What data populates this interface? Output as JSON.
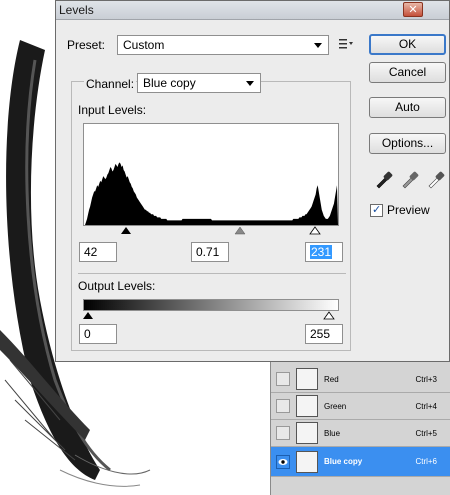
{
  "dialog": {
    "title": "Levels",
    "close_glyph": "✕",
    "preset_label": "Preset:",
    "preset_value": "Custom",
    "channel_label": "Channel:",
    "channel_value": "Blue copy",
    "input_levels_label": "Input Levels:",
    "input_black": "42",
    "input_gamma": "0.71",
    "input_white": "231",
    "output_levels_label": "Output Levels:",
    "output_black": "0",
    "output_white": "255"
  },
  "buttons": {
    "ok": "OK",
    "cancel": "Cancel",
    "auto": "Auto",
    "options": "Options..."
  },
  "preview": {
    "label": "Preview",
    "checked": true
  },
  "channels": [
    {
      "name": "Red",
      "shortcut": "Ctrl+3",
      "selected": false
    },
    {
      "name": "Green",
      "shortcut": "Ctrl+4",
      "selected": false
    },
    {
      "name": "Blue",
      "shortcut": "Ctrl+5",
      "selected": false
    },
    {
      "name": "Blue copy",
      "shortcut": "Ctrl+6",
      "selected": true
    }
  ],
  "histogram": [
    0,
    0,
    2,
    4,
    7,
    10,
    12,
    15,
    18,
    20,
    22,
    22,
    24,
    26,
    25,
    27,
    29,
    28,
    30,
    32,
    31,
    30,
    31,
    33,
    34,
    36,
    38,
    37,
    35,
    36,
    38,
    40,
    39,
    38,
    40,
    41,
    40,
    38,
    39,
    36,
    35,
    33,
    31,
    32,
    30,
    28,
    27,
    25,
    24,
    22,
    21,
    20,
    18,
    17,
    16,
    15,
    14,
    13,
    12,
    11,
    10,
    10,
    9,
    9,
    8,
    8,
    7,
    7,
    7,
    6,
    6,
    6,
    5,
    5,
    5,
    5,
    4,
    4,
    4,
    4,
    4,
    4,
    3,
    3,
    3,
    3,
    3,
    3,
    3,
    3,
    3,
    3,
    3,
    3,
    3,
    3,
    3,
    4,
    4,
    4,
    4,
    4,
    4,
    4,
    4,
    4,
    4,
    4,
    4,
    4,
    4,
    4,
    4,
    4,
    4,
    4,
    4,
    4,
    4,
    4,
    4,
    4,
    4,
    4,
    4,
    4,
    3,
    3,
    3,
    3,
    3,
    3,
    3,
    3,
    3,
    3,
    3,
    3,
    3,
    3,
    3,
    3,
    3,
    3,
    3,
    3,
    3,
    3,
    3,
    3,
    3,
    3,
    3,
    3,
    3,
    3,
    3,
    3,
    3,
    3,
    3,
    3,
    3,
    3,
    3,
    3,
    3,
    3,
    3,
    3,
    3,
    3,
    3,
    3,
    3,
    3,
    3,
    3,
    3,
    3,
    3,
    3,
    3,
    3,
    3,
    3,
    3,
    3,
    3,
    3,
    3,
    3,
    3,
    3,
    3,
    3,
    3,
    3,
    3,
    3,
    3,
    3,
    3,
    3,
    3,
    3,
    4,
    4,
    4,
    4,
    4,
    4,
    5,
    5,
    5,
    6,
    6,
    6,
    7,
    7,
    8,
    9,
    10,
    11,
    12,
    14,
    16,
    18,
    20,
    24,
    26,
    22,
    18,
    14,
    10,
    8,
    6,
    5,
    4,
    4,
    4,
    5,
    6,
    8,
    10,
    12,
    14,
    18,
    22,
    26
  ],
  "colors": {
    "accent": "#3a78c9",
    "selection": "#3b8ff0"
  }
}
